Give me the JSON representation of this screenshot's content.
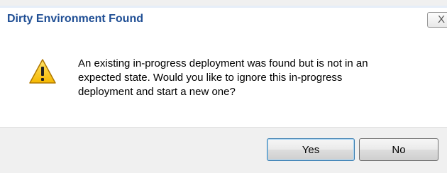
{
  "dialog": {
    "title": "Dirty Environment Found",
    "close_glyph": "X",
    "icon": "warning-icon",
    "message_lines": [
      "An existing in-progress deployment was found but is not in an",
      "expected state.  Would you like to ignore this in-progress",
      "deployment and start a new one?"
    ],
    "buttons": {
      "yes_label": "Yes",
      "no_label": "No"
    }
  },
  "colors": {
    "title_text": "#1f4e94",
    "warning_fill": "#f5c400",
    "warning_stroke": "#b07800"
  }
}
